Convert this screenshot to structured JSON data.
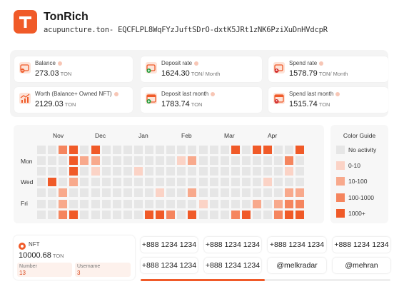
{
  "app": {
    "title": "TonRich",
    "address": "acupuncture.ton- EQCFLPL8WqFYzJuftSDrO-dxtK5JRt1zNK6PziXuDnHVdcpR",
    "brand_color": "#f05a28"
  },
  "stats": [
    {
      "label": "Balance",
      "value": "273.03",
      "unit": "TON",
      "icon": "wallet-icon"
    },
    {
      "label": "Deposit rate",
      "value": "1624.30",
      "unit": "TON/ Month",
      "icon": "deposit-wallet-icon"
    },
    {
      "label": "Spend rate",
      "value": "1578.79",
      "unit": "TON/ Month",
      "icon": "spend-wallet-icon"
    },
    {
      "label": "Worth (Balance+ Owned NFT)",
      "value": "2129.03",
      "unit": "TON",
      "icon": "chart-trend-icon"
    },
    {
      "label": "Deposit last month",
      "value": "1783.74",
      "unit": "TON",
      "icon": "deposit-calendar-icon"
    },
    {
      "label": "Spend last month",
      "value": "1515.74",
      "unit": "TON",
      "icon": "spend-calendar-icon"
    }
  ],
  "heatmap": {
    "months": [
      "Nov",
      "Dec",
      "Jan",
      "Feb",
      "Mar",
      "Apr"
    ],
    "days": [
      "Mon",
      "Wed",
      "Fri"
    ],
    "colors": {
      "0": "#e6e6e6",
      "1": "#fbd3c6",
      "2": "#f8a98c",
      "3": "#f5855e",
      "4": "#f05a28"
    },
    "grid": [
      [
        0,
        0,
        3,
        4,
        0,
        4,
        0,
        0,
        0,
        0,
        0,
        0,
        0,
        0,
        0,
        0,
        0,
        0,
        4,
        0,
        4,
        4,
        0,
        0,
        4
      ],
      [
        0,
        0,
        0,
        4,
        2,
        2,
        0,
        0,
        0,
        0,
        0,
        0,
        0,
        1,
        2,
        0,
        0,
        0,
        0,
        0,
        0,
        0,
        0,
        3,
        0
      ],
      [
        0,
        0,
        0,
        4,
        0,
        1,
        0,
        0,
        0,
        1,
        0,
        0,
        0,
        0,
        0,
        0,
        0,
        0,
        0,
        0,
        0,
        0,
        0,
        1,
        0
      ],
      [
        0,
        4,
        0,
        2,
        0,
        0,
        0,
        0,
        0,
        0,
        0,
        0,
        0,
        0,
        0,
        0,
        0,
        0,
        0,
        0,
        0,
        1,
        0,
        0,
        0
      ],
      [
        0,
        0,
        2,
        0,
        0,
        0,
        0,
        0,
        0,
        0,
        0,
        1,
        0,
        0,
        2,
        0,
        0,
        0,
        0,
        0,
        0,
        0,
        0,
        2,
        2
      ],
      [
        0,
        0,
        2,
        0,
        0,
        0,
        0,
        0,
        0,
        0,
        0,
        0,
        0,
        0,
        0,
        1,
        0,
        0,
        0,
        0,
        2,
        0,
        2,
        3,
        3
      ],
      [
        0,
        0,
        3,
        4,
        0,
        0,
        0,
        0,
        0,
        0,
        4,
        4,
        3,
        0,
        4,
        0,
        0,
        0,
        3,
        4,
        0,
        0,
        3,
        4,
        4
      ]
    ]
  },
  "guide": {
    "title": "Color Guide",
    "items": [
      {
        "label": "No activity",
        "color": "#e6e6e6"
      },
      {
        "label": "0-10",
        "color": "#fbd3c6"
      },
      {
        "label": "10-100",
        "color": "#f8a98c"
      },
      {
        "label": "100-1000",
        "color": "#f5855e"
      },
      {
        "label": "1000+",
        "color": "#f05a28"
      }
    ]
  },
  "nft": {
    "title": "NFT",
    "value": "10000.68",
    "unit": "TON",
    "number_label": "Number",
    "number_value": "13",
    "username_label": "Username",
    "username_value": "3"
  },
  "pills": [
    [
      "+888 1234 1234",
      "+888 1234 1234",
      "+888 1234 1234",
      "+888 1234 1234"
    ],
    [
      "+888 1234 1234",
      "+888 1234 1234",
      "@melkradar",
      "@mehran"
    ]
  ],
  "scroll": {
    "position_fraction": 0.5
  }
}
